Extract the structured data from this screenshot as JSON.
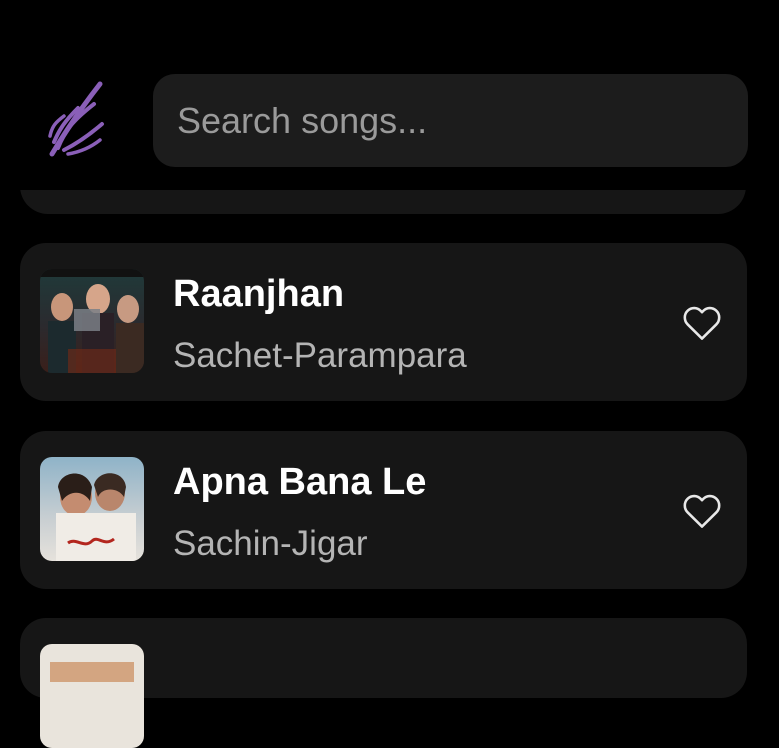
{
  "app": {
    "logo_icon": "feather-logo-icon",
    "accent_color": "#8a5fb8"
  },
  "search": {
    "placeholder": "Search songs..."
  },
  "songs": [
    {
      "title": "Raanjhan",
      "artist": "Sachet-Parampara",
      "artwork_icon": "do-patti-album-art",
      "favorite_icon": "heart-outline-icon"
    },
    {
      "title": "Apna Bana Le",
      "artist": "Sachin-Jigar",
      "artwork_icon": "bhediya-album-art",
      "favorite_icon": "heart-outline-icon"
    }
  ]
}
